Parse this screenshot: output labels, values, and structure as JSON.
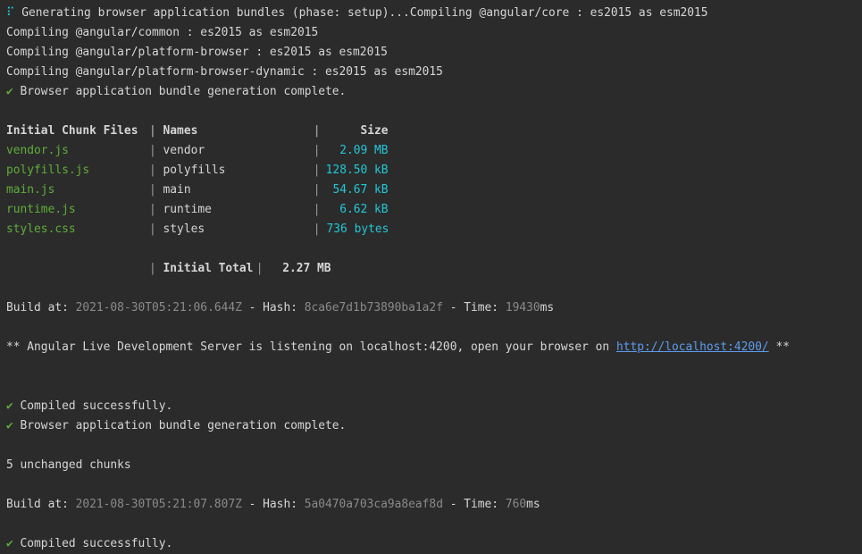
{
  "colors": {
    "background": "#2b2b2b",
    "text": "#d6d6d6",
    "green": "#5fae3a",
    "cyan": "#23c7d6",
    "gray": "#8a8a8a",
    "link": "#5d9cec"
  },
  "lines": {
    "l1_icon": "⠏",
    "l1_text": " Generating browser application bundles (phase: setup)...Compiling @angular/core : es2015 as esm2015",
    "l2": "Compiling @angular/common : es2015 as esm2015",
    "l3": "Compiling @angular/platform-browser : es2015 as esm2015",
    "l4": "Compiling @angular/platform-browser-dynamic : es2015 as esm2015",
    "check": "✔",
    "l5": " Browser application bundle generation complete."
  },
  "table": {
    "headers": {
      "files": "Initial Chunk Files",
      "names": "Names",
      "size": "Size"
    },
    "sep": "|",
    "rows": [
      {
        "file": "vendor.js",
        "name": "vendor",
        "size": "2.09 MB"
      },
      {
        "file": "polyfills.js",
        "name": "polyfills",
        "size": "128.50 kB"
      },
      {
        "file": "main.js",
        "name": "main",
        "size": "54.67 kB"
      },
      {
        "file": "runtime.js",
        "name": "runtime",
        "size": "6.62 kB"
      },
      {
        "file": "styles.css",
        "name": "styles",
        "size": "736 bytes"
      }
    ],
    "total_label": "Initial Total",
    "total_value": "2.27 MB"
  },
  "build1": {
    "label_build": "Build at: ",
    "time": "2021-08-30T05:21:06.644Z",
    "label_hash": " - Hash: ",
    "hash": "8ca6e7d1b73890ba1a2f",
    "label_time": " - Time: ",
    "ms": "19430",
    "ms_suffix": "ms"
  },
  "server": {
    "prefix": "** Angular Live Development Server is listening on localhost:4200, open your browser on ",
    "url": "http://localhost:4200/",
    "suffix": " **"
  },
  "compiled1": " Compiled successfully.",
  "bundle2": " Browser application bundle generation complete.",
  "unchanged": "5 unchanged chunks",
  "build2": {
    "label_build": "Build at: ",
    "time": "2021-08-30T05:21:07.807Z",
    "label_hash": " - Hash: ",
    "hash": "5a0470a703ca9a8eaf8d",
    "label_time": " - Time: ",
    "ms": "760",
    "ms_suffix": "ms"
  },
  "compiled2": " Compiled successfully."
}
